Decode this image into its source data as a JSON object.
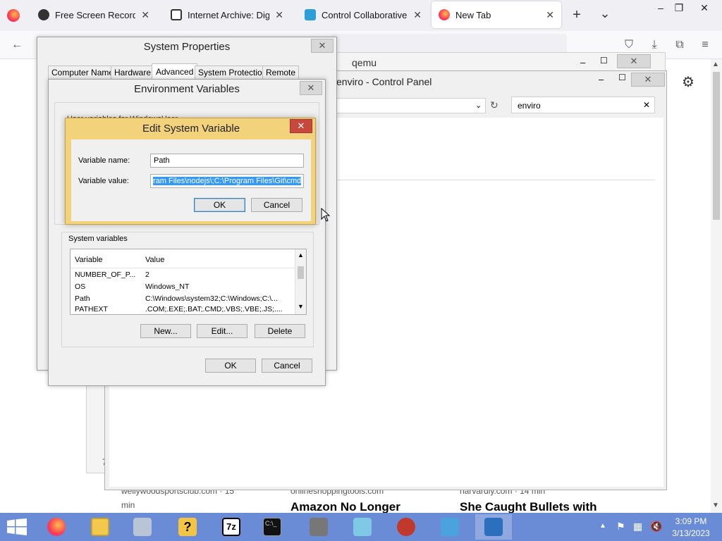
{
  "browser": {
    "tabs": [
      {
        "label": "Free Screen Recorder - N",
        "icon": "gear-icon"
      },
      {
        "label": "Internet Archive: Digital L",
        "icon": "archive-icon"
      },
      {
        "label": "Control Collaborative Vir",
        "icon": "monitor-icon"
      },
      {
        "label": "New Tab",
        "icon": "firefox-icon",
        "active": true
      }
    ],
    "new_tab_symbol": "+",
    "list_tabs_symbol": "⌄",
    "close_symbol": "✕"
  },
  "background_windows": {
    "qemu_title": "qemu",
    "control_panel_title": "enviro - Control Panel",
    "search_value": "enviro"
  },
  "page_bg": {
    "card1_title": "Amazon No Longer",
    "card1_source": "onlineshoppingtools.com",
    "card2_title": "She Caught Bullets with",
    "card2_source": "harvardly.com · 14 min",
    "card0_source": "wellywoodsportsclub.com · 15",
    "card0_min": "min",
    "card_left_fragment": "7"
  },
  "system_properties": {
    "title": "System Properties",
    "tabs": [
      "Computer Name",
      "Hardware",
      "Advanced",
      "System Protection",
      "Remote"
    ],
    "active_tab": "Advanced"
  },
  "env_vars": {
    "title": "Environment Variables",
    "hidden_label": "User variables for WindowsUser",
    "system_label": "System variables",
    "columns": [
      "Variable",
      "Value"
    ],
    "rows": [
      {
        "variable": "NUMBER_OF_P...",
        "value": "2"
      },
      {
        "variable": "OS",
        "value": "Windows_NT"
      },
      {
        "variable": "Path",
        "value": "C:\\Windows\\system32;C:\\Windows;C:\\..."
      },
      {
        "variable": "PATHEXT",
        "value": ".COM;.EXE;.BAT;.CMD;.VBS;.VBE;.JS;...."
      }
    ],
    "new_button": "New...",
    "edit_button": "Edit...",
    "delete_button": "Delete",
    "ok_button": "OK",
    "cancel_button": "Cancel"
  },
  "edit_dialog": {
    "title": "Edit System Variable",
    "name_label": "Variable name:",
    "name_value": "Path",
    "value_label": "Variable value:",
    "value_value": "ram Files\\nodejs\\;C:\\Program Files\\Git\\cmd",
    "ok_button": "OK",
    "cancel_button": "Cancel"
  },
  "taskbar": {
    "time": "3:09 PM",
    "date": "3/13/2023",
    "apps": [
      "firefox-icon",
      "file-explorer-icon",
      "installer-icon",
      "help-icon",
      "7zip-icon",
      "terminal-icon",
      "qemu-icon",
      "notepad-icon",
      "app-icon",
      "control-panel-icon",
      "remote-desktop-icon"
    ]
  },
  "colors": {
    "taskbar": "#6a8bd6",
    "dialog_frame": "#f3d27c",
    "close_red": "#c7483c",
    "selection": "#3399ff"
  }
}
